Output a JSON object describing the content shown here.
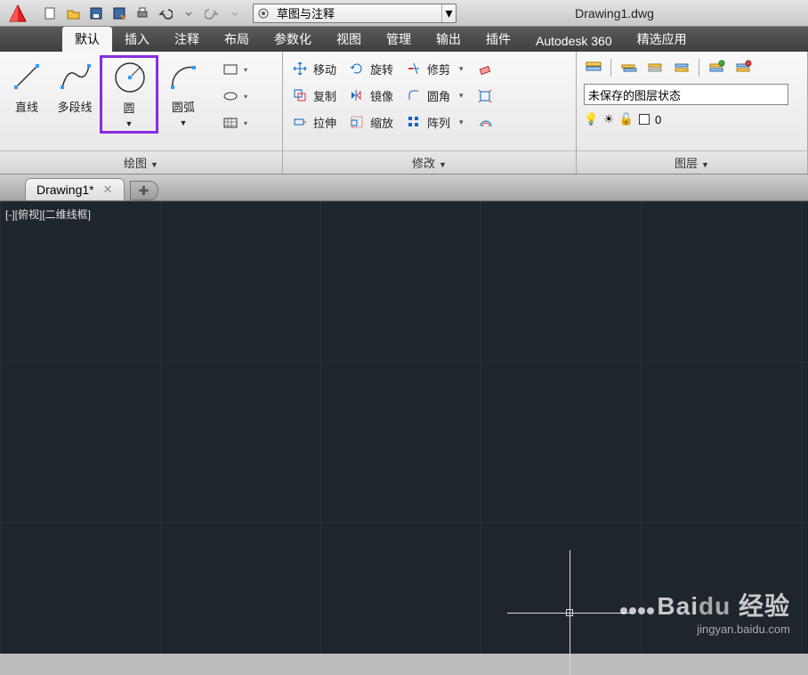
{
  "titlebar": {
    "doc_title": "Drawing1.dwg",
    "workspace_label": "草图与注释"
  },
  "tabs": [
    "默认",
    "插入",
    "注释",
    "布局",
    "参数化",
    "视图",
    "管理",
    "输出",
    "插件",
    "Autodesk 360",
    "精选应用"
  ],
  "active_tab": 0,
  "draw_panel": {
    "title": "绘图",
    "line": "直线",
    "polyline": "多段线",
    "circle": "圆",
    "arc": "圆弧"
  },
  "modify_panel": {
    "title": "修改",
    "move": "移动",
    "copy": "复制",
    "stretch": "拉伸",
    "rotate": "旋转",
    "mirror": "镜像",
    "scale": "缩放",
    "trim": "修剪",
    "fillet": "圆角",
    "array": "阵列"
  },
  "layer_panel": {
    "title": "图层",
    "state_label": "未保存的图层状态",
    "current_layer": "0"
  },
  "doc_tab": "Drawing1*",
  "viewport_label": "[-][俯视][二维线框]",
  "watermark": {
    "brand": "Bai",
    "brand2": "du",
    "sub": "经验",
    "url": "jingyan.baidu.com"
  }
}
